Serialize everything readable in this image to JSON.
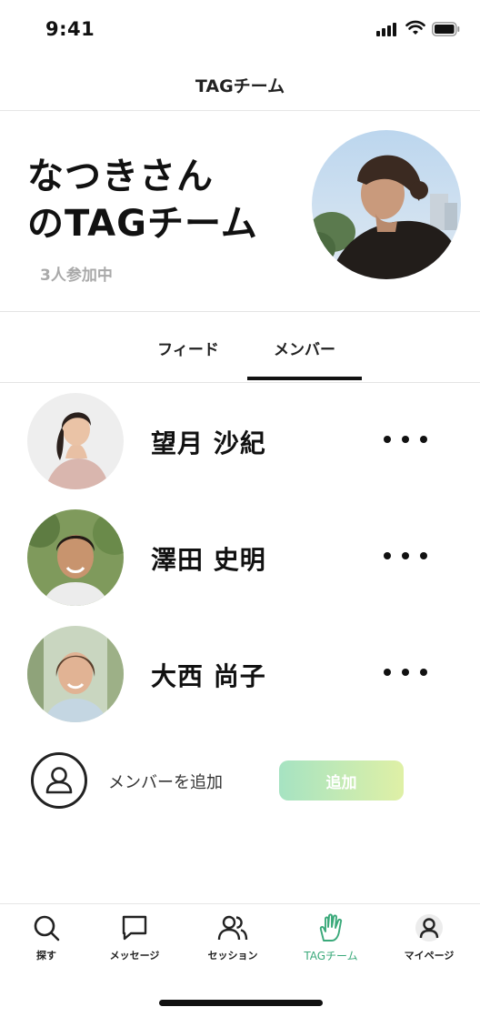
{
  "status_bar": {
    "time": "9:41"
  },
  "header": {
    "title": "TAGチーム"
  },
  "team": {
    "name_line1": "なつきさん",
    "name_line2": "のTAGチーム",
    "member_count": "3人参加中"
  },
  "tabs": [
    {
      "label": "フィード",
      "active": false
    },
    {
      "label": "メンバー",
      "active": true
    }
  ],
  "members": [
    {
      "name": "望月 沙紀"
    },
    {
      "name": "澤田 史明"
    },
    {
      "name": "大西 尚子"
    }
  ],
  "add_member": {
    "label": "メンバーを追加",
    "button": "追加"
  },
  "bottom_nav": [
    {
      "label": "探す",
      "icon": "search-icon"
    },
    {
      "label": "メッセージ",
      "icon": "message-icon"
    },
    {
      "label": "セッション",
      "icon": "users-icon"
    },
    {
      "label": "TAGチーム",
      "icon": "hand-icon",
      "active": true
    },
    {
      "label": "マイページ",
      "icon": "profile-icon"
    }
  ],
  "colors": {
    "accent": "#3aa97a",
    "button_gradient_start": "#a6e3c2",
    "button_gradient_end": "#dff0a6"
  }
}
